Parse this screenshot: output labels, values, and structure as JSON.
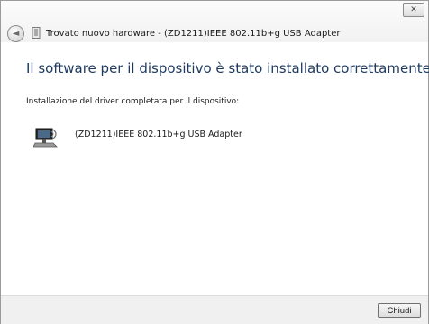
{
  "window": {
    "title": "Trovato nuovo hardware - (ZD1211)IEEE 802.11b+g USB Adapter",
    "close_glyph": "✕"
  },
  "icons": {
    "back": "back-arrow-icon",
    "title_icon": "hardware-icon",
    "device": "network-adapter-icon"
  },
  "content": {
    "heading": "Il software per il dispositivo è stato installato correttamente",
    "subtitle": "Installazione del driver completata per il dispositivo:",
    "device_name": "(ZD1211)IEEE 802.11b+g USB Adapter"
  },
  "footer": {
    "finish_label": "Chiudi"
  }
}
